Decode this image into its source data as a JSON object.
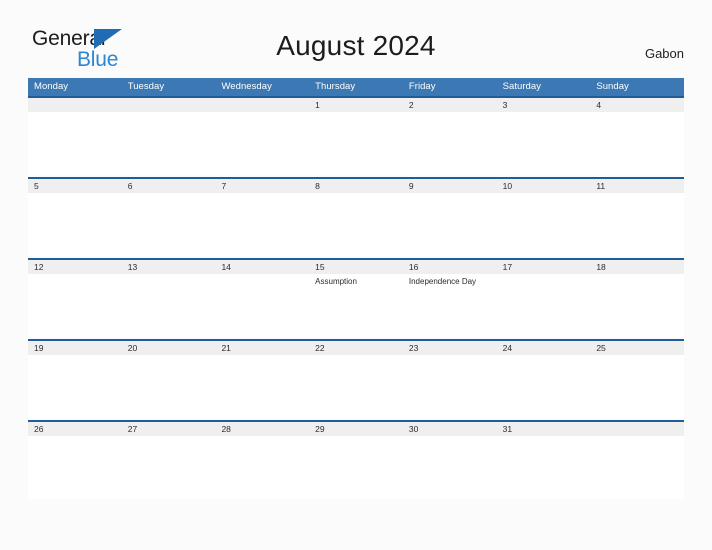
{
  "brand": {
    "name_part1": "General",
    "name_part2": "Blue",
    "triangle_icon": "blue-triangle-icon",
    "color_dark": "#1c1c1c",
    "color_blue": "#2b87d3",
    "color_triangle": "#1f6cb4"
  },
  "header": {
    "title": "August 2024",
    "country": "Gabon"
  },
  "theme": {
    "header_blue": "#3c78b4",
    "band_gray": "#efefef",
    "band_rule": "#1f5c99",
    "page_bg": "#fbfbfb"
  },
  "weekdays": [
    {
      "label": "Monday"
    },
    {
      "label": "Tuesday"
    },
    {
      "label": "Wednesday"
    },
    {
      "label": "Thursday"
    },
    {
      "label": "Friday"
    },
    {
      "label": "Saturday"
    },
    {
      "label": "Sunday"
    }
  ],
  "weeks": [
    {
      "days": [
        {
          "num": "",
          "event": ""
        },
        {
          "num": "",
          "event": ""
        },
        {
          "num": "",
          "event": ""
        },
        {
          "num": "1",
          "event": ""
        },
        {
          "num": "2",
          "event": ""
        },
        {
          "num": "3",
          "event": ""
        },
        {
          "num": "4",
          "event": ""
        }
      ]
    },
    {
      "days": [
        {
          "num": "5",
          "event": ""
        },
        {
          "num": "6",
          "event": ""
        },
        {
          "num": "7",
          "event": ""
        },
        {
          "num": "8",
          "event": ""
        },
        {
          "num": "9",
          "event": ""
        },
        {
          "num": "10",
          "event": ""
        },
        {
          "num": "11",
          "event": ""
        }
      ]
    },
    {
      "days": [
        {
          "num": "12",
          "event": ""
        },
        {
          "num": "13",
          "event": ""
        },
        {
          "num": "14",
          "event": ""
        },
        {
          "num": "15",
          "event": "Assumption"
        },
        {
          "num": "16",
          "event": "Independence Day"
        },
        {
          "num": "17",
          "event": ""
        },
        {
          "num": "18",
          "event": ""
        }
      ]
    },
    {
      "days": [
        {
          "num": "19",
          "event": ""
        },
        {
          "num": "20",
          "event": ""
        },
        {
          "num": "21",
          "event": ""
        },
        {
          "num": "22",
          "event": ""
        },
        {
          "num": "23",
          "event": ""
        },
        {
          "num": "24",
          "event": ""
        },
        {
          "num": "25",
          "event": ""
        }
      ]
    },
    {
      "days": [
        {
          "num": "26",
          "event": ""
        },
        {
          "num": "27",
          "event": ""
        },
        {
          "num": "28",
          "event": ""
        },
        {
          "num": "29",
          "event": ""
        },
        {
          "num": "30",
          "event": ""
        },
        {
          "num": "31",
          "event": ""
        },
        {
          "num": "",
          "event": ""
        }
      ]
    }
  ]
}
